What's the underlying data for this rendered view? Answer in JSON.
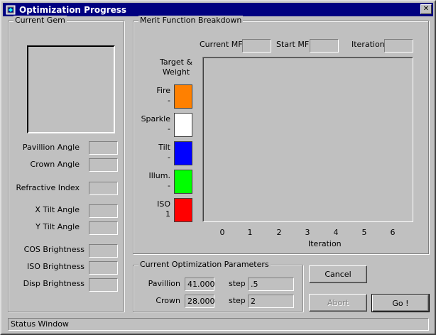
{
  "window": {
    "title": "Optimization Progress",
    "close_glyph": "✕",
    "icon": "gem-app-icon"
  },
  "current_gem": {
    "group_label": "Current Gem",
    "fields": [
      {
        "label": "Pavillion Angle",
        "value": ""
      },
      {
        "label": "Crown Angle",
        "value": ""
      },
      {
        "label": "Refractive Index",
        "value": ""
      },
      {
        "label": "X Tilt Angle",
        "value": ""
      },
      {
        "label": "Y Tilt Angle",
        "value": ""
      },
      {
        "label": "COS Brightness",
        "value": ""
      },
      {
        "label": "ISO Brightness",
        "value": ""
      },
      {
        "label": "Disp Brightness",
        "value": ""
      }
    ]
  },
  "merit": {
    "group_label": "Merit Function Breakdown",
    "current_mf_label": "Current MF",
    "current_mf_value": "",
    "start_mf_label": "Start MF",
    "start_mf_value": "",
    "iteration_label": "Iteration",
    "iteration_value": "",
    "target_weight_label_1": "Target &",
    "target_weight_label_2": "Weight",
    "components": [
      {
        "name": "Fire",
        "weight": "-",
        "color": "#ff8000"
      },
      {
        "name": "Sparkle",
        "weight": "-",
        "color": "#ffffff"
      },
      {
        "name": "Tilt",
        "weight": "-",
        "color": "#0000ff"
      },
      {
        "name": "Illum.",
        "weight": "-",
        "color": "#00ff00"
      },
      {
        "name": "ISO",
        "weight": "1",
        "color": "#ff0000"
      }
    ],
    "x_ticks": [
      "0",
      "1",
      "2",
      "3",
      "4",
      "5",
      "6"
    ],
    "x_axis_label": "Iteration"
  },
  "params": {
    "group_label": "Current Optimization Parameters",
    "pavillion_label": "Pavillion",
    "pavillion_value": "41.000",
    "pavillion_step_label": "step",
    "pavillion_step_value": ".5",
    "crown_label": "Crown",
    "crown_value": "28.000",
    "crown_step_label": "step",
    "crown_step_value": "2"
  },
  "buttons": {
    "cancel": "Cancel",
    "abort": "Abort",
    "go": "Go !"
  },
  "status": {
    "text": "Status Window"
  }
}
